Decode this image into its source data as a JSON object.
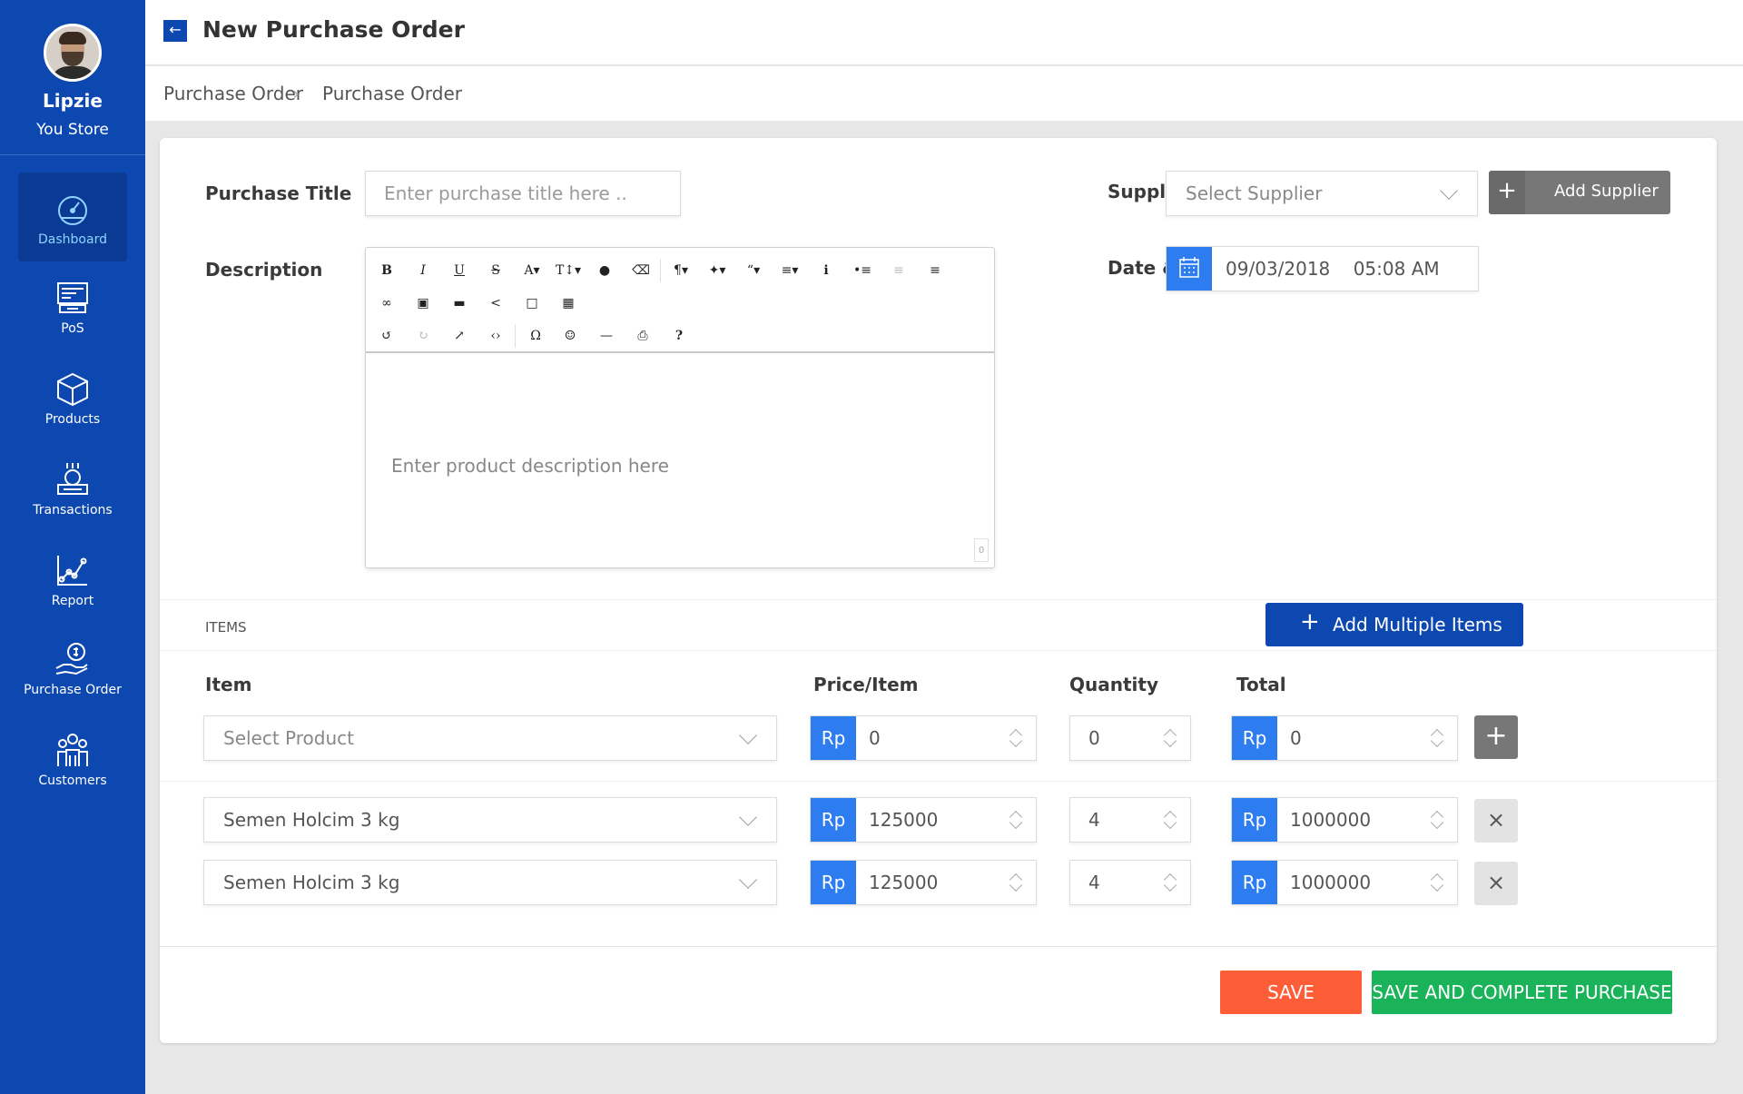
{
  "user": {
    "name": "Lipzie",
    "store": "You Store"
  },
  "sidebar": {
    "items": [
      {
        "label": "Dashboard",
        "icon": "speedometer-icon",
        "active": true
      },
      {
        "label": "PoS",
        "icon": "pos-terminal-icon"
      },
      {
        "label": "Products",
        "icon": "box-icon"
      },
      {
        "label": "Transactions",
        "icon": "cash-register-icon"
      },
      {
        "label": "Report",
        "icon": "line-chart-icon"
      },
      {
        "label": "Purchase Order",
        "icon": "hand-coin-icon"
      },
      {
        "label": "Customers",
        "icon": "people-icon"
      }
    ]
  },
  "header": {
    "title": "New Purchase Order",
    "back_icon": "arrow-left-icon"
  },
  "breadcrumb": [
    "Purchase Order",
    "Purchase Order"
  ],
  "form": {
    "purchase_title_label": "Purchase Title",
    "purchase_title_placeholder": "Enter purchase title here ..",
    "description_label": "Description",
    "description_placeholder": "Enter product description here",
    "char_count": "0",
    "supplier_label": "Supplier",
    "supplier_placeholder": "Select Supplier",
    "add_supplier_label": "Add Supplier",
    "datetime_label": "Date & Time",
    "datetime_value": "09/03/2018    05:08 AM"
  },
  "items_section": {
    "label": "ITEMS",
    "add_multiple_label": "Add Multiple Items",
    "columns": [
      "Item",
      "Price/Item",
      "Quantity",
      "Total"
    ],
    "currency": "Rp",
    "new_row": {
      "item_placeholder": "Select Product",
      "price": "0",
      "quantity": "0",
      "total": "0"
    },
    "rows": [
      {
        "item": "Semen Holcim 3 kg",
        "price": "125000",
        "quantity": "4",
        "total": "1000000"
      },
      {
        "item": "Semen Holcim 3 kg",
        "price": "125000",
        "quantity": "4",
        "total": "1000000"
      }
    ]
  },
  "actions": {
    "save": "SAVE",
    "save_complete": "SAVE AND COMPLETE PURCHASE"
  },
  "colors": {
    "sidebar": "#0d47b0",
    "accent": "#2d7df0",
    "save": "#fd5d37",
    "complete": "#1ab35a"
  }
}
